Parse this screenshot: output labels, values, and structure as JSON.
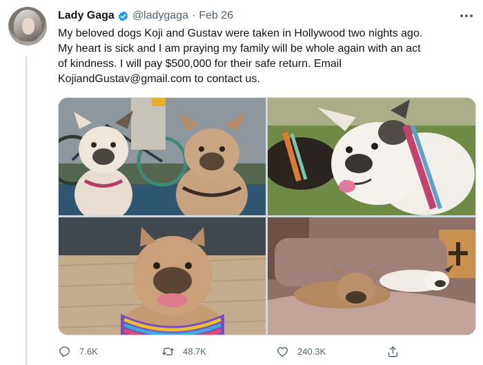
{
  "tweet": {
    "author_name": "Lady Gaga",
    "handle": "@ladygaga",
    "separator": "·",
    "date": "Feb 26",
    "text_lines": [
      "My beloved dogs Koji and Gustav were taken in Hollywood two nights ago.",
      "My heart is sick and I am praying my family will be whole again with an act",
      "of kindness. I will pay $500,000 for their safe return. Email",
      "KojiandGustav@gmail.com to contact us."
    ]
  },
  "actions": {
    "reply_count": "7.6K",
    "retweet_count": "48.7K",
    "like_count": "240.3K"
  },
  "colors": {
    "verified": "#1d9bf0",
    "secondary_text": "#536471",
    "primary_text": "#0f1419"
  },
  "icons": [
    "verified-badge-icon",
    "more-options-icon",
    "reply-icon",
    "retweet-icon",
    "like-icon",
    "share-icon"
  ]
}
